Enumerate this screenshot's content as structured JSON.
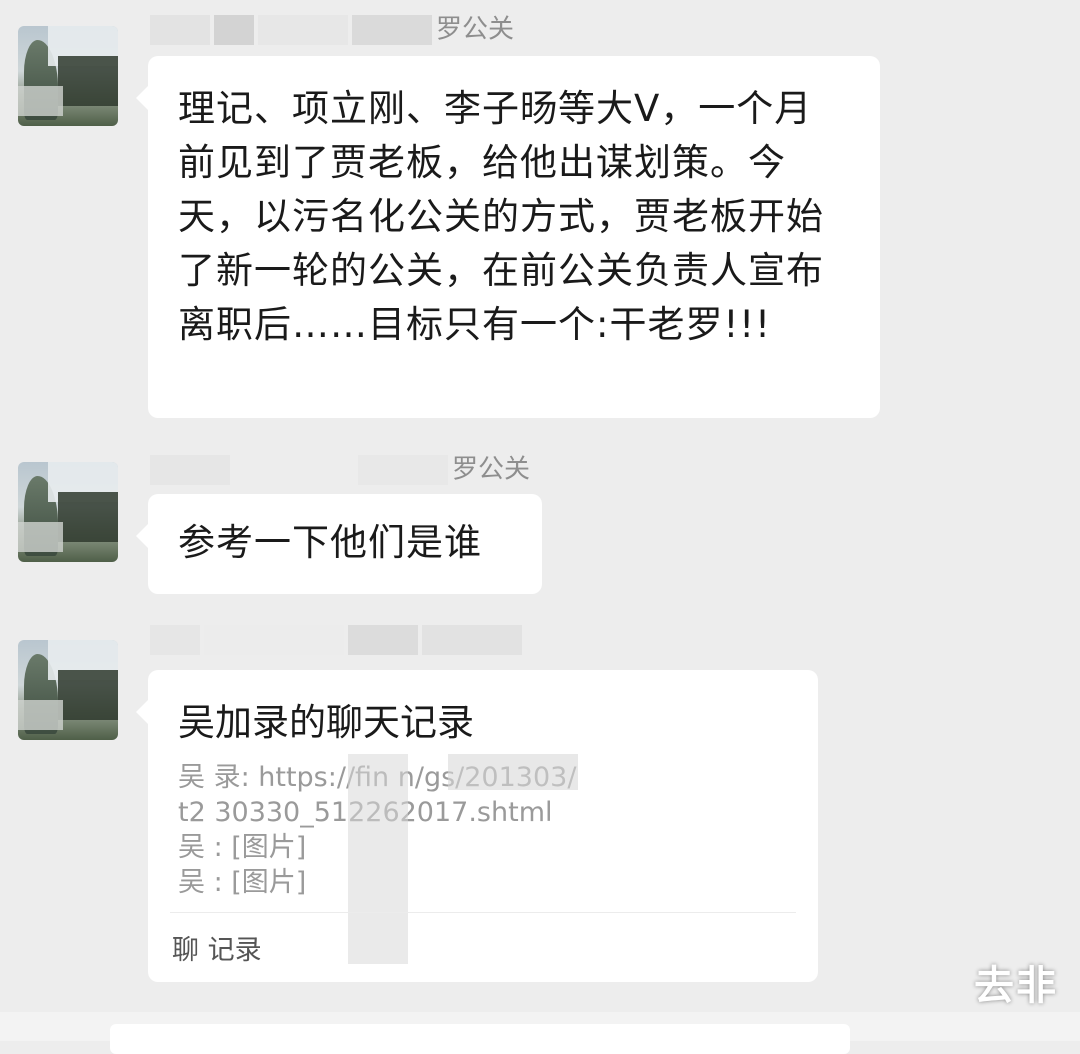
{
  "messages": [
    {
      "sender_suffix": "罗公关",
      "text": "理记、项立刚、李子旸等大V，一个月前见到了贾老板，给他出谋划策。今天，以污名化公关的方式，贾老板开始了新一轮的公关，在前公关负责人宣布离职后……目标只有一个:干老罗!!!"
    },
    {
      "sender_suffix": "罗公关",
      "text": "参考一下他们是谁"
    },
    {
      "sender_suffix": "",
      "chat_record": {
        "title": "吴加录的聊天记录",
        "lines": [
          "吴 录: https://fin           n/gs/201303/",
          "t2  30330_512262017.shtml",
          "吴  : [图片]",
          "吴  : [图片]"
        ],
        "footer": "聊  记录"
      }
    }
  ],
  "watermark": "去非"
}
